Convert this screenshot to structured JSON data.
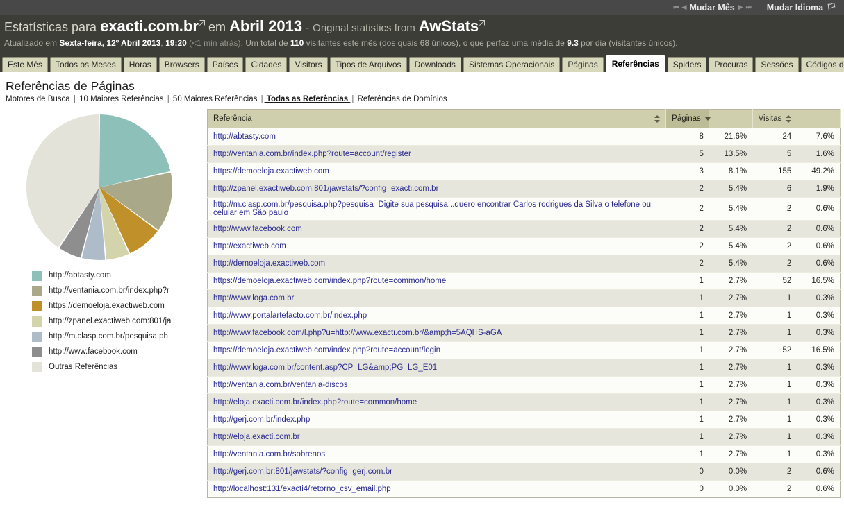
{
  "topbar": {
    "month_nav": {
      "first": "⏮",
      "prev": "◀",
      "label": "Mudar Mês",
      "next": "▶",
      "last": "⏭"
    },
    "language": {
      "label": "Mudar Idioma",
      "flag": "🏳"
    }
  },
  "header": {
    "title_prefix": "Estatísticas para",
    "site": "exacti.com.br",
    "title_mid": "em",
    "period": "Abril 2013",
    "dash": "-",
    "source_prefix": "Original statistics from",
    "source": "AwStats",
    "updated_prefix": "Atualizado em",
    "updated_date": "Sexta-feira, 12º Abril 2013",
    "updated_comma": ",",
    "updated_time": "19:20",
    "updated_ago": "(<1 min atrás).",
    "total_prefix": "Um total de",
    "total_visitors": "110",
    "total_mid": "visitantes este mês (dos quais 68 únicos), o que perfaz uma média de",
    "avg": "9.3",
    "total_suffix": "por dia (visitantes únicos)."
  },
  "tabs": [
    {
      "label": "Este Mês",
      "active": false
    },
    {
      "label": "Todos os Meses",
      "active": false
    },
    {
      "label": "Horas",
      "active": false
    },
    {
      "label": "Browsers",
      "active": false
    },
    {
      "label": "Países",
      "active": false
    },
    {
      "label": "Cidades",
      "active": false
    },
    {
      "label": "Visitors",
      "active": false
    },
    {
      "label": "Tipos de Arquivos",
      "active": false
    },
    {
      "label": "Downloads",
      "active": false
    },
    {
      "label": "Sistemas Operacionais",
      "active": false
    },
    {
      "label": "Páginas",
      "active": false
    },
    {
      "label": "Referências",
      "active": true
    },
    {
      "label": "Spiders",
      "active": false
    },
    {
      "label": "Procuras",
      "active": false
    },
    {
      "label": "Sessões",
      "active": false
    },
    {
      "label": "Códigos de estado",
      "active": false
    }
  ],
  "page": {
    "title": "Referências de Páginas",
    "crumbs": [
      {
        "label": "Motores de Busca",
        "current": false
      },
      {
        "label": "10 Maiores Referências",
        "current": false
      },
      {
        "label": "50 Maiores Referências",
        "current": false
      },
      {
        "label": "Todas as Referências",
        "current": true
      },
      {
        "label": "Referências de Domínios",
        "current": false
      }
    ],
    "crumb_sep": "|"
  },
  "chart_data": {
    "type": "pie",
    "title": "Referências de Páginas",
    "legend_position": "bottom-left",
    "value_label": "Páginas",
    "labels": [
      "http://abtasty.com",
      "http://ventania.com.br/index.php?r",
      "https://demoeloja.exactiweb.com",
      "http://zpanel.exactiweb.com:801/ja",
      "http://m.clasp.com.br/pesquisa.ph",
      "http://www.facebook.com",
      "Outras Referências"
    ],
    "values": [
      21.6,
      13.5,
      8.1,
      5.4,
      5.4,
      5.4,
      40.6
    ],
    "colors": [
      "#8cc0b8",
      "#a9a98a",
      "#c0902a",
      "#d3d3ac",
      "#aebcca",
      "#8e8e8e",
      "#e3e3da"
    ]
  },
  "table": {
    "columns": [
      {
        "key": "reference",
        "label": "Referência",
        "sort": "both",
        "sorted": false
      },
      {
        "key": "pages",
        "label": "Páginas",
        "sort": "desc",
        "sorted": true
      },
      {
        "key": "pages_pct",
        "label": "",
        "sort": "none",
        "sorted": false
      },
      {
        "key": "visits",
        "label": "Visitas",
        "sort": "both",
        "sorted": false
      },
      {
        "key": "visits_pct",
        "label": "",
        "sort": "none",
        "sorted": false
      }
    ],
    "rows": [
      {
        "reference": "http://abtasty.com",
        "pages": "8",
        "pages_pct": "21.6%",
        "visits": "24",
        "visits_pct": "7.6%"
      },
      {
        "reference": "http://ventania.com.br/index.php?route=account/register",
        "pages": "5",
        "pages_pct": "13.5%",
        "visits": "5",
        "visits_pct": "1.6%"
      },
      {
        "reference": "https://demoeloja.exactiweb.com",
        "pages": "3",
        "pages_pct": "8.1%",
        "visits": "155",
        "visits_pct": "49.2%"
      },
      {
        "reference": "http://zpanel.exactiweb.com:801/jawstats/?config=exacti.com.br",
        "pages": "2",
        "pages_pct": "5.4%",
        "visits": "6",
        "visits_pct": "1.9%"
      },
      {
        "reference": "http://m.clasp.com.br/pesquisa.php?pesquisa=Digite sua pesquisa...quero encontrar Carlos rodrigues da Silva o telefone ou celular em São paulo",
        "pages": "2",
        "pages_pct": "5.4%",
        "visits": "2",
        "visits_pct": "0.6%"
      },
      {
        "reference": "http://www.facebook.com",
        "pages": "2",
        "pages_pct": "5.4%",
        "visits": "2",
        "visits_pct": "0.6%"
      },
      {
        "reference": "http://exactiweb.com",
        "pages": "2",
        "pages_pct": "5.4%",
        "visits": "2",
        "visits_pct": "0.6%"
      },
      {
        "reference": "http://demoeloja.exactiweb.com",
        "pages": "2",
        "pages_pct": "5.4%",
        "visits": "2",
        "visits_pct": "0.6%"
      },
      {
        "reference": "https://demoeloja.exactiweb.com/index.php?route=common/home",
        "pages": "1",
        "pages_pct": "2.7%",
        "visits": "52",
        "visits_pct": "16.5%"
      },
      {
        "reference": "http://www.loga.com.br",
        "pages": "1",
        "pages_pct": "2.7%",
        "visits": "1",
        "visits_pct": "0.3%"
      },
      {
        "reference": "http://www.portalartefacto.com.br/index.php",
        "pages": "1",
        "pages_pct": "2.7%",
        "visits": "1",
        "visits_pct": "0.3%"
      },
      {
        "reference": "http://www.facebook.com/l.php?u=http://www.exacti.com.br/&amp;h=5AQHS-aGA",
        "pages": "1",
        "pages_pct": "2.7%",
        "visits": "1",
        "visits_pct": "0.3%"
      },
      {
        "reference": "https://demoeloja.exactiweb.com/index.php?route=account/login",
        "pages": "1",
        "pages_pct": "2.7%",
        "visits": "52",
        "visits_pct": "16.5%"
      },
      {
        "reference": "http://www.loga.com.br/content.asp?CP=LG&amp;PG=LG_E01",
        "pages": "1",
        "pages_pct": "2.7%",
        "visits": "1",
        "visits_pct": "0.3%"
      },
      {
        "reference": "http://ventania.com.br/ventania-discos",
        "pages": "1",
        "pages_pct": "2.7%",
        "visits": "1",
        "visits_pct": "0.3%"
      },
      {
        "reference": "http://eloja.exacti.com.br/index.php?route=common/home",
        "pages": "1",
        "pages_pct": "2.7%",
        "visits": "1",
        "visits_pct": "0.3%"
      },
      {
        "reference": "http://gerj.com.br/index.php",
        "pages": "1",
        "pages_pct": "2.7%",
        "visits": "1",
        "visits_pct": "0.3%"
      },
      {
        "reference": "http://eloja.exacti.com.br",
        "pages": "1",
        "pages_pct": "2.7%",
        "visits": "1",
        "visits_pct": "0.3%"
      },
      {
        "reference": "http://ventania.com.br/sobrenos",
        "pages": "1",
        "pages_pct": "2.7%",
        "visits": "1",
        "visits_pct": "0.3%"
      },
      {
        "reference": "http://gerj.com.br:801/jawstats/?config=gerj.com.br",
        "pages": "0",
        "pages_pct": "0.0%",
        "visits": "2",
        "visits_pct": "0.6%"
      },
      {
        "reference": "http://localhost:131/exacti4/retorno_csv_email.php",
        "pages": "0",
        "pages_pct": "0.0%",
        "visits": "2",
        "visits_pct": "0.6%"
      }
    ]
  }
}
